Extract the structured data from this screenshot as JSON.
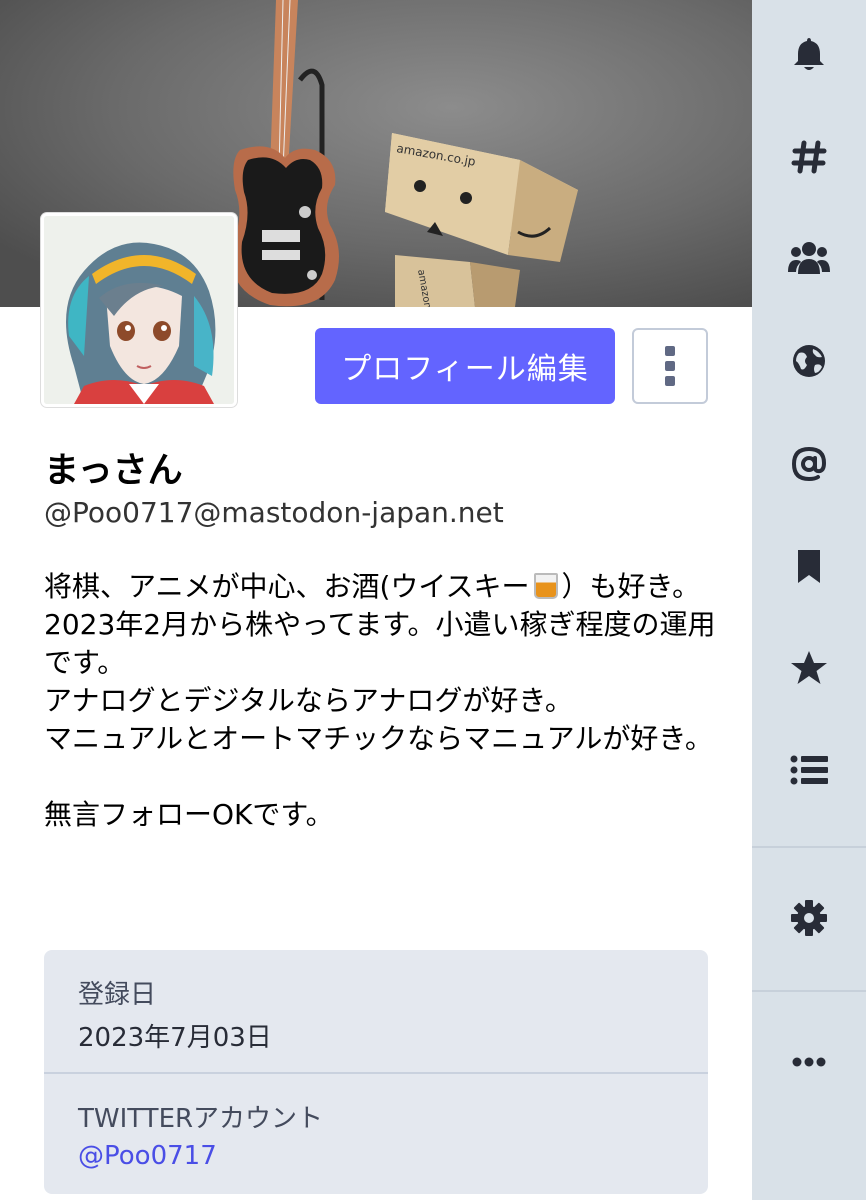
{
  "profile": {
    "display_name": "まっさん",
    "acct": "@Poo0717@mastodon-japan.net",
    "edit_button": "プロフィール編集",
    "bio": {
      "line1_before": "将棋、アニメが中心、お酒(ウイスキー",
      "line1_after": "）も好き。",
      "paragraph1_rest": "2023年2月から株やってます。小遣い稼ぎ程度の運用です。\nアナログとデジタルならアナログが好き。\nマニュアルとオートマチックならマニュアルが好き。",
      "paragraph2": "無言フォローOKです。"
    },
    "fields": [
      {
        "label": "登録日",
        "value": "2023年7月03日"
      },
      {
        "label": "TWITTERアカウント",
        "value": "@Poo0717"
      }
    ]
  },
  "header_image": {
    "box_text_1": "amazon.co.jp",
    "box_text_2": "amazon.co"
  },
  "nav": {
    "items": [
      {
        "icon": "bell-icon"
      },
      {
        "icon": "hashtag-icon"
      },
      {
        "icon": "users-icon"
      },
      {
        "icon": "globe-icon"
      },
      {
        "icon": "at-icon"
      },
      {
        "icon": "bookmark-icon"
      },
      {
        "icon": "star-icon"
      },
      {
        "icon": "list-icon"
      },
      {
        "icon": "gear-icon"
      },
      {
        "icon": "more-icon"
      }
    ]
  },
  "colors": {
    "accent": "#6364ff",
    "nav_bg": "#d9e1e8",
    "nav_icon": "#282c37",
    "field_bg": "#e4e8ef",
    "link": "#4a4ee6"
  }
}
